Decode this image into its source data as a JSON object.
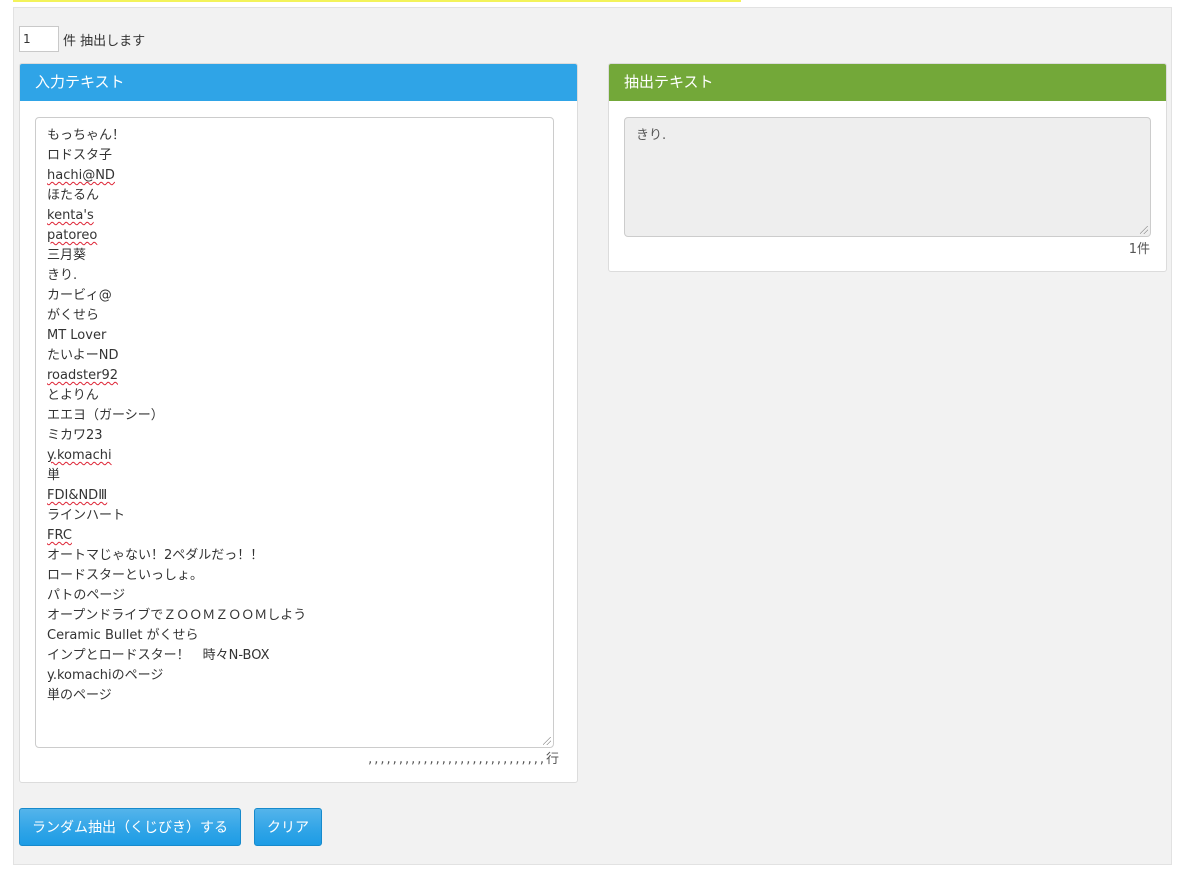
{
  "count": {
    "value": "1",
    "suffix": "件 抽出します"
  },
  "input_panel": {
    "title": "入力テキスト",
    "lines": [
      {
        "text": "もっちゃん！",
        "spell": false
      },
      {
        "text": "ロドスタ子",
        "spell": false
      },
      {
        "text": "hachi@ND",
        "spell": true
      },
      {
        "text": "ほたるん",
        "spell": false
      },
      {
        "text": "kenta's",
        "spell": true
      },
      {
        "text": "patoreo",
        "spell": true
      },
      {
        "text": "三月葵",
        "spell": false
      },
      {
        "text": "きり.",
        "spell": false
      },
      {
        "text": "カービィ@",
        "spell": false
      },
      {
        "text": "がくせら",
        "spell": false
      },
      {
        "text": "MT Lover",
        "spell": false
      },
      {
        "text": "たいよーND",
        "spell": false
      },
      {
        "text": "roadster92",
        "spell": true
      },
      {
        "text": "とよりん",
        "spell": false
      },
      {
        "text": "エエヨ（ガーシー）",
        "spell": false
      },
      {
        "text": "ミカワ23",
        "spell": false
      },
      {
        "text": "y.komachi",
        "spell": true
      },
      {
        "text": "単",
        "spell": false
      },
      {
        "text": "FDⅠ&NDⅢ",
        "spell": true
      },
      {
        "text": "ラインハート",
        "spell": false
      },
      {
        "text": "FRC",
        "spell": true
      },
      {
        "text": "オートマじゃない！2ペダルだっ！！",
        "spell": false
      },
      {
        "text": "ロードスターといっしょ。",
        "spell": false
      },
      {
        "text": "パトのページ",
        "spell": false
      },
      {
        "text": "オープンドライブでＺＯＯＭＺＯＯＭしよう",
        "spell": false
      },
      {
        "text": "Ceramic Bullet がくせら",
        "spell": false
      },
      {
        "text": "インプとロードスター！　時々N-BOX",
        "spell": false
      },
      {
        "text": "y.komachiのページ",
        "spell": false
      },
      {
        "text": "単のページ",
        "spell": false
      }
    ],
    "line_counter": ",,,,,,,,,,,,,,,,,,,,,,,,,,,,,行"
  },
  "output_panel": {
    "title": "抽出テキスト",
    "value": "きり.",
    "count_label": "1件"
  },
  "buttons": {
    "random_label": "ランダム抽出（くじびき）する",
    "clear_label": "クリア"
  },
  "colors": {
    "input_header": "#2fa4e7",
    "output_header": "#73a839",
    "button": "#2fa4e7"
  }
}
